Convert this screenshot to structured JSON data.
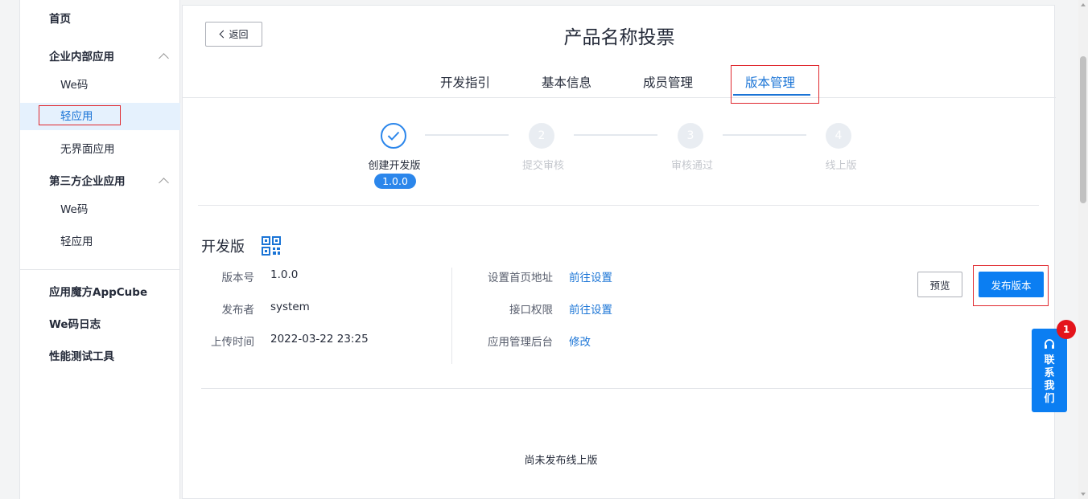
{
  "sidebar": {
    "home": "首页",
    "group_internal": "企业内部应用",
    "internal_items": [
      "We码",
      "轻应用",
      "无界面应用"
    ],
    "group_third": "第三方企业应用",
    "third_items": [
      "We码",
      "轻应用"
    ],
    "appcube": "应用魔方AppCube",
    "we_log": "We码日志",
    "perf_tool": "性能测试工具"
  },
  "header": {
    "back_label": "返回",
    "title": "产品名称投票"
  },
  "tabs": [
    "开发指引",
    "基本信息",
    "成员管理",
    "版本管理"
  ],
  "steps": {
    "labels": [
      "创建开发版",
      "提交审核",
      "审核通过",
      "线上版"
    ],
    "numbers": [
      "2",
      "3",
      "4"
    ],
    "current_version": "1.0.0"
  },
  "dev": {
    "section_title": "开发版",
    "version_label": "版本号",
    "version_value": "1.0.0",
    "publisher_label": "发布者",
    "publisher_value": "system",
    "upload_label": "上传时间",
    "upload_value": "2022-03-22 23:25",
    "home_url_label": "设置首页地址",
    "home_url_link": "前往设置",
    "api_perm_label": "接口权限",
    "api_perm_link": "前往设置",
    "admin_label": "应用管理后台",
    "admin_link": "修改",
    "preview_btn": "预览",
    "publish_btn": "发布版本"
  },
  "online": {
    "empty_text": "尚未发布线上版"
  },
  "contact": {
    "text_lines": [
      "联",
      "系",
      "我",
      "们"
    ],
    "badge": "1"
  },
  "colors": {
    "accent": "#0b7ef2",
    "link": "#1a74d6",
    "highlight_box": "#e0282e"
  }
}
